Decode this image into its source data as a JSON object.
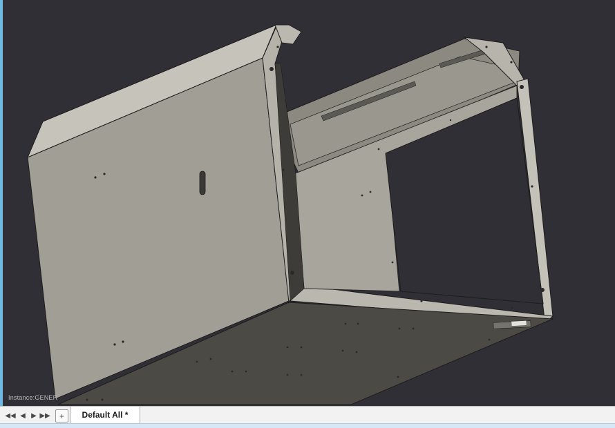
{
  "viewport": {
    "instance_label": "Instance:GENER"
  },
  "tabbar": {
    "nav_first": "◀◀",
    "nav_prev": "◀",
    "nav_next": "▶",
    "nav_last": "▶▶",
    "add_label": "+",
    "active_tab": "Default All *"
  },
  "colors": {
    "background": "#2f2f35",
    "panel_light": "#bfbcb4",
    "panel_mid": "#a9a69e",
    "panel_dark": "#4a4843",
    "accent_edge": "#6fb8e6"
  }
}
